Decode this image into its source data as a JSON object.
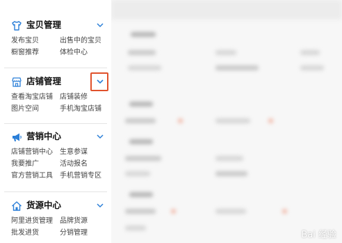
{
  "sidebar": {
    "sections": [
      {
        "title": "宝贝管理",
        "icon": "shirt-icon",
        "links": [
          "发布宝贝",
          "出售中的宝贝",
          "橱窗推荐",
          "体检中心"
        ]
      },
      {
        "title": "店铺管理",
        "icon": "store-icon",
        "links": [
          "查看淘宝店铺",
          "店铺装修",
          "图片空间",
          "手机淘宝店铺"
        ]
      },
      {
        "title": "营销中心",
        "icon": "megaphone-icon",
        "links": [
          "店铺营销中心",
          "生意参谋",
          "我要推广",
          "活动报名",
          "官方营销工具",
          "手机营销专区"
        ]
      },
      {
        "title": "货源中心",
        "icon": "house-icon",
        "links": [
          "阿里进货管理",
          "品牌货源",
          "批发进货",
          "分销管理"
        ]
      }
    ]
  },
  "colors": {
    "accent_blue": "#2b7fd8",
    "highlight_red": "#e0512b"
  },
  "watermark": {
    "text": "Bai 经验"
  }
}
